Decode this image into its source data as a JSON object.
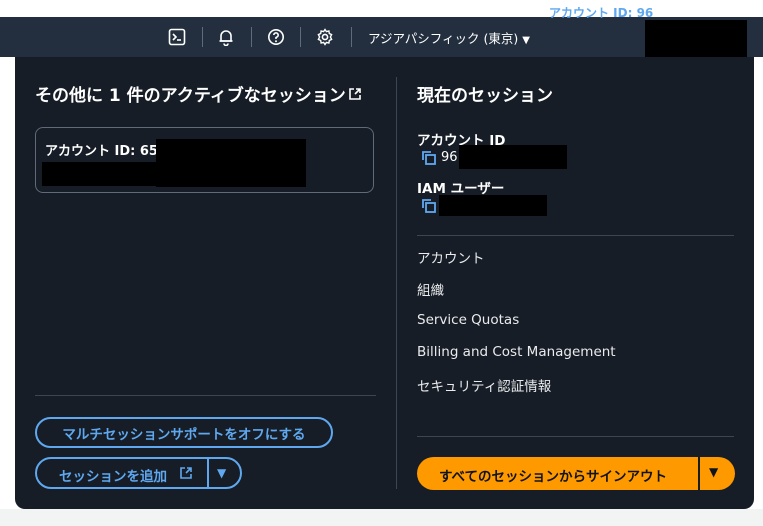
{
  "header": {
    "region": "アジアパシフィック (東京)",
    "region_caret": "▼",
    "account_label": "アカウント ID: 96",
    "icons": [
      "cloudshell-icon",
      "bell-icon",
      "help-icon",
      "gear-icon"
    ]
  },
  "other_sessions": {
    "title": "その他に 1 件のアクティブなセッション",
    "session_card_label": "アカウント ID: 65",
    "turn_off_button": "マルチセッションサポートをオフにする",
    "add_session_button": "セッションを追加",
    "dropdown_caret": "▼"
  },
  "current_session": {
    "title": "現在のセッション",
    "account_id_label": "アカウント ID",
    "account_id_value": "96",
    "iam_user_label": "IAM ユーザー",
    "menu": [
      "アカウント",
      "組織",
      "Service Quotas",
      "Billing and Cost Management",
      "セキュリティ認証情報"
    ],
    "signout_button": "すべてのセッションからサインアウト",
    "signout_caret": "▼"
  },
  "colors": {
    "panel_bg": "#161d26",
    "header_bg": "#232f3e",
    "link_blue": "#5fa8f0",
    "accent_orange": "#ff9900"
  }
}
